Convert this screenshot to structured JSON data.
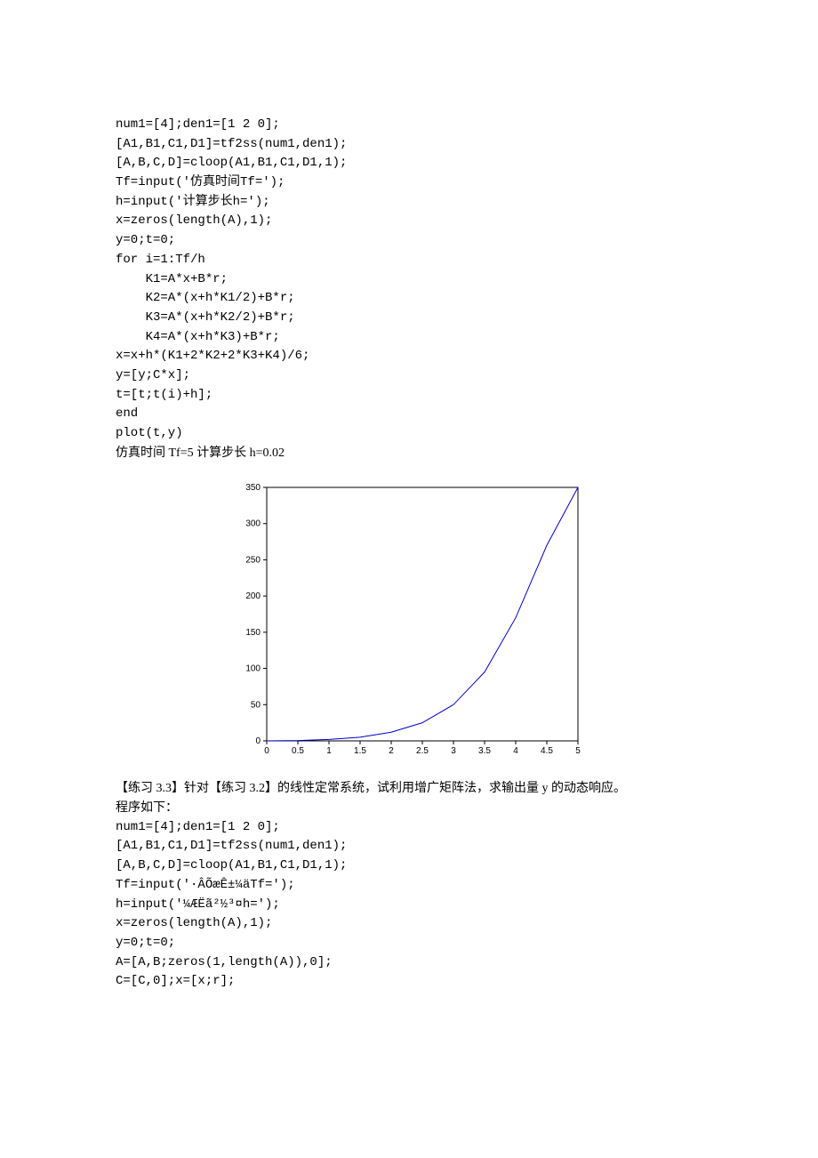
{
  "code1": [
    "num1=[4];den1=[1 2 0];",
    "[A1,B1,C1,D1]=tf2ss(num1,den1);",
    "[A,B,C,D]=cloop(A1,B1,C1,D1,1);",
    "Tf=input('仿真时间Tf=');",
    "h=input('计算步长h=');",
    "x=zeros(length(A),1);",
    "y=0;t=0;",
    "for i=1:Tf/h",
    "    K1=A*x+B*r;",
    "    K2=A*(x+h*K1/2)+B*r;",
    "    K3=A*(x+h*K2/2)+B*r;",
    "    K4=A*(x+h*K3)+B*r;",
    "x=x+h*(K1+2*K2+2*K3+K4)/6;",
    "y=[y;C*x];",
    "t=[t;t(i)+h];",
    "end",
    "plot(t,y)"
  ],
  "params": [
    "仿真时间 Tf=5",
    "计算步长 h=0.02"
  ],
  "chart_data": {
    "type": "line",
    "x": [
      0,
      0.5,
      1,
      1.5,
      2,
      2.5,
      3,
      3.5,
      4,
      4.5,
      5
    ],
    "values": [
      0,
      0.5,
      2,
      5,
      12,
      25,
      50,
      95,
      170,
      270,
      350
    ],
    "xticks": [
      0,
      0.5,
      1,
      1.5,
      2,
      2.5,
      3,
      3.5,
      4,
      4.5,
      5
    ],
    "yticks": [
      0,
      50,
      100,
      150,
      200,
      250,
      300,
      350
    ],
    "xlim": [
      0,
      5
    ],
    "ylim": [
      0,
      350
    ]
  },
  "exercise_text": "【练习 3.3】针对【练习 3.2】的线性定常系统，试利用增广矩阵法，求输出量 y 的动态响应。",
  "program_label": "程序如下：",
  "code2": [
    "num1=[4];den1=[1 2 0];",
    "[A1,B1,C1,D1]=tf2ss(num1,den1);",
    "[A,B,C,D]=cloop(A1,B1,C1,D1,1);",
    "Tf=input('·ÂÕæÊ±¼äTf=');",
    "h=input('¼ÆËã²½³¤h=');",
    "x=zeros(length(A),1);",
    "y=0;t=0;",
    "A=[A,B;zeros(1,length(A)),0];",
    "C=[C,0];x=[x;r];"
  ]
}
